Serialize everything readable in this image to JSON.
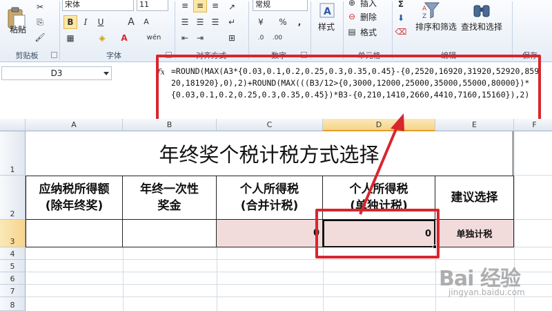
{
  "ribbon": {
    "clipboard": {
      "paste_label": "粘贴",
      "group_label": "剪贴板"
    },
    "font": {
      "font_name": "宋体",
      "font_size": "11",
      "bold": "B",
      "italic": "I",
      "underline": "U",
      "grow": "A",
      "shrink": "A",
      "phonetic": "wén",
      "font_color": "A",
      "group_label": "字体"
    },
    "alignment": {
      "group_label": "对齐方式"
    },
    "number": {
      "format": "常规",
      "percent": "%",
      "comma": ",",
      "group_label": "数字"
    },
    "styles": {
      "label": "样式"
    },
    "cells": {
      "insert_label": "插入",
      "delete_label": "删除",
      "format_label": "格式",
      "group_label": "单元格"
    },
    "editing": {
      "sort_filter_label": "排序和筛选",
      "find_select_label": "查找和选择",
      "group_label": "编辑"
    },
    "save": {
      "group_label": "保存"
    }
  },
  "formula_bar": {
    "name_box": "D3",
    "fx": "fx",
    "formula": "=ROUND(MAX(A3*{0.03,0.1,0.2,0.25,0.3,0.35,0.45}-{0,2520,16920,31920,52920,85920,181920},0),2)+ROUND(MAX(((B3/12>{0,3000,12000,25000,35000,55000,80000})*{0.03,0.1,0.2,0.25,0.3,0.35,0.45})*B3-{0,210,1410,2660,4410,7160,15160}),2)"
  },
  "grid": {
    "columns": [
      "A",
      "B",
      "C",
      "D",
      "E",
      "F"
    ],
    "rows": [
      "1",
      "2",
      "3",
      "4",
      "5",
      "6",
      "7",
      "8"
    ],
    "selected_cell": "D3",
    "title": "年终奖个税计税方式选择",
    "header_row": [
      {
        "line1": "应纳税所得额",
        "line2": "(除年终奖)"
      },
      {
        "line1": "年终一次性",
        "line2": "奖金"
      },
      {
        "line1": "个人所得税",
        "line2": "(合并计税)"
      },
      {
        "line1": "个人所得税",
        "line2": "(单独计税)"
      },
      {
        "line1": "建议选择",
        "line2": ""
      }
    ],
    "row3": {
      "A": "",
      "B": "",
      "C": "0",
      "D": "0",
      "E": "单独计税"
    }
  },
  "watermark": {
    "main": "Bai 经验",
    "sub": "jingyan.baidu.com"
  },
  "colors": {
    "highlight": "#d8262e",
    "pink_fill": "#f2dcdb",
    "selected_header": "#f7d48a"
  }
}
